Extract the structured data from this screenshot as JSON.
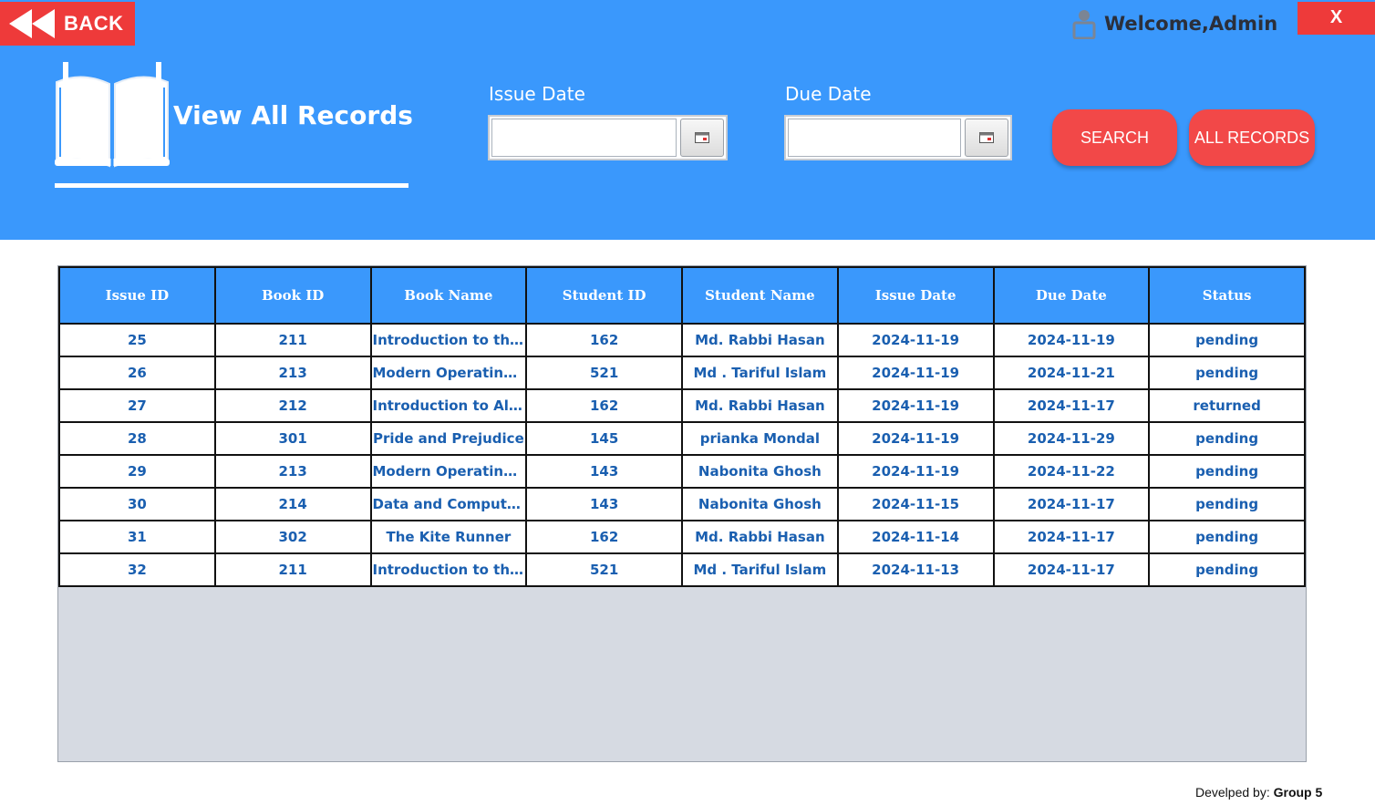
{
  "header": {
    "back_label": "BACK",
    "close_label": "X",
    "welcome": "Welcome,Admin",
    "title": "View All Records"
  },
  "filters": {
    "issue_date_label": "Issue Date",
    "issue_date_value": "",
    "due_date_label": "Due Date",
    "due_date_value": "",
    "search_label": "SEARCH",
    "all_records_label": "ALL RECORDS"
  },
  "table": {
    "columns": [
      "Issue ID",
      "Book ID",
      "Book Name",
      "Student ID",
      "Student Name",
      "Issue Date",
      "Due Date",
      "Status"
    ],
    "rows": [
      [
        "25",
        "211",
        "Introduction to the T...",
        "162",
        "Md. Rabbi Hasan",
        "2024-11-19",
        "2024-11-19",
        "pending"
      ],
      [
        "26",
        "213",
        "Modern Operating S...",
        "521",
        "Md . Tariful Islam",
        "2024-11-19",
        "2024-11-21",
        "pending"
      ],
      [
        "27",
        "212",
        "Introduction to Algo...",
        "162",
        "Md. Rabbi Hasan",
        "2024-11-19",
        "2024-11-17",
        "returned"
      ],
      [
        "28",
        "301",
        "Pride and Prejudice",
        "145",
        "prianka Mondal",
        "2024-11-19",
        "2024-11-29",
        "pending"
      ],
      [
        "29",
        "213",
        "Modern Operating S...",
        "143",
        "Nabonita Ghosh",
        "2024-11-19",
        "2024-11-22",
        "pending"
      ],
      [
        "30",
        "214",
        "Data and Computer C...",
        "143",
        "Nabonita Ghosh",
        "2024-11-15",
        "2024-11-17",
        "pending"
      ],
      [
        "31",
        "302",
        "The Kite Runner",
        "162",
        "Md. Rabbi Hasan",
        "2024-11-14",
        "2024-11-17",
        "pending"
      ],
      [
        "32",
        "211",
        "Introduction to the T...",
        "521",
        "Md . Tariful Islam",
        "2024-11-13",
        "2024-11-17",
        "pending"
      ]
    ]
  },
  "footer": {
    "prefix": "Develped by: ",
    "group": "Group  5"
  },
  "icons": {
    "back": "rewind-icon",
    "user": "user-icon",
    "book": "open-book-icon",
    "calendar": "calendar-icon"
  },
  "colors": {
    "header_bg": "#3a98fc",
    "button_red": "#f24848",
    "cell_text": "#1a5fb0",
    "empty_area": "#d6dae2"
  }
}
